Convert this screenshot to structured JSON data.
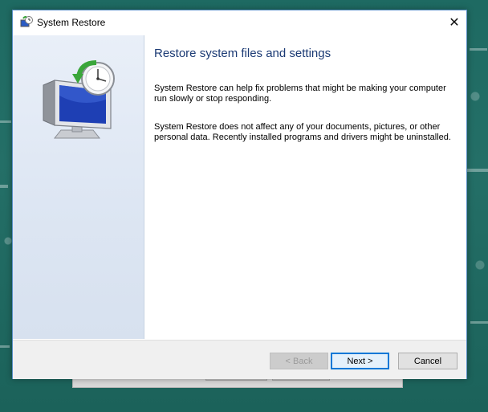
{
  "window": {
    "title": "System Restore",
    "close_glyph": "✕"
  },
  "content": {
    "heading": "Restore system files and settings",
    "paragraph_1": "System Restore can help fix problems that might be making your computer run slowly or stop responding.",
    "paragraph_2": "System Restore does not affect any of your documents, pictures, or other personal data. Recently installed programs and drivers might be uninstalled."
  },
  "buttons": {
    "back": "< Back",
    "next": "Next >",
    "cancel": "Cancel"
  },
  "colors": {
    "heading": "#1b3a74",
    "accent": "#0078d7",
    "sidebar": "#dde6f3",
    "desktop": "#1f6b63"
  },
  "icons": {
    "title": "system-restore-icon",
    "hero": "system-restore-monitor-clock-icon"
  }
}
